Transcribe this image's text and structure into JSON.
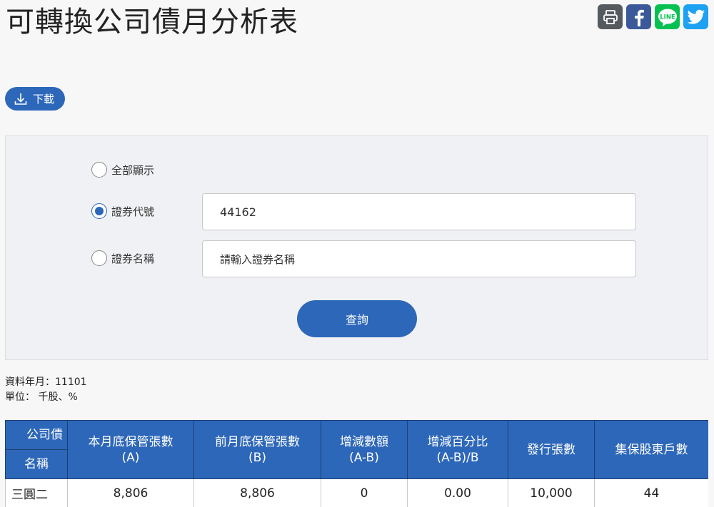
{
  "page": {
    "title": "可轉換公司債月分析表"
  },
  "share": {
    "print_icon": "printer-icon",
    "facebook_icon": "facebook-icon",
    "line_icon": "line-icon",
    "line_text": "LINE",
    "twitter_icon": "twitter-icon"
  },
  "download": {
    "label": "下載",
    "icon": "download-icon"
  },
  "query": {
    "options": [
      {
        "label": "全部顯示",
        "checked": false
      },
      {
        "label": "證券代號",
        "checked": true
      },
      {
        "label": "證券名稱",
        "checked": false
      }
    ],
    "code_value": "44162",
    "name_placeholder": "請輸入證券名稱",
    "submit_label": "查詢"
  },
  "meta": {
    "period": "資料年月：11101",
    "unit": "單位： 千股、%"
  },
  "table": {
    "group_header": "公司債",
    "name_header": "名稱",
    "headers": [
      {
        "line1": "本月底保管張數",
        "line2": "(A)"
      },
      {
        "line1": "前月底保管張數",
        "line2": "(B)"
      },
      {
        "line1": "增減數額",
        "line2": "(A-B)"
      },
      {
        "line1": "增減百分比",
        "line2": "(A-B)/B"
      },
      {
        "line1": "發行張數",
        "line2": ""
      },
      {
        "line1": "集保股東戶數",
        "line2": ""
      }
    ],
    "rows": [
      {
        "name": "三圓二",
        "current": "8,806",
        "previous": "8,806",
        "change": "0",
        "change_pct": "0.00",
        "issued": "10,000",
        "holders": "44"
      }
    ]
  },
  "colors": {
    "accent": "#2d67b9",
    "panel": "#f0f1f4",
    "background": "#f7f7f7"
  }
}
